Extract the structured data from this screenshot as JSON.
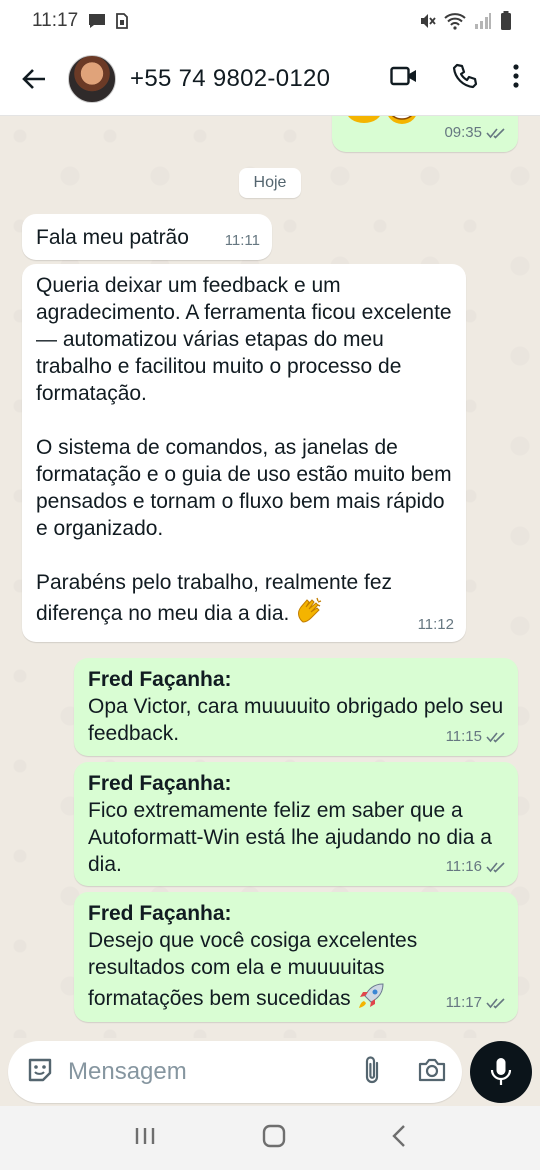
{
  "status_bar": {
    "time": "11:17",
    "icons": [
      "chat-notification-icon",
      "sim-icon",
      "mute-icon",
      "wifi-icon",
      "signal-icon",
      "battery-icon"
    ]
  },
  "header": {
    "contact_name": "+55 74 9802-0120",
    "actions": [
      "video-call-icon",
      "voice-call-icon",
      "more-options-icon"
    ]
  },
  "chat": {
    "prev_message": {
      "time": "09:35"
    },
    "day_label": "Hoje",
    "messages": [
      {
        "direction": "in",
        "text": "Fala meu patrão",
        "time": "11:11"
      },
      {
        "direction": "in",
        "paragraphs": [
          "Queria deixar um feedback e um agradecimento. A ferramenta ficou excelente — automatizou várias etapas do meu trabalho e facilitou muito o processo de formatação.",
          "O sistema de comandos, as janelas de formatação e o guia de uso estão muito bem pensados e tornam o fluxo bem mais rápido e organizado.",
          "Parabéns pelo trabalho, realmente fez diferença no meu dia a dia."
        ],
        "time": "11:12"
      },
      {
        "direction": "out",
        "sender": "Fred Façanha:",
        "text": "Opa Victor, cara muuuuito obrigado pelo seu feedback.",
        "time": "11:15"
      },
      {
        "direction": "out",
        "sender": "Fred Façanha:",
        "text": "Fico extremamente feliz em saber que a Autoformatt-Win está lhe ajudando no dia a dia.",
        "time": "11:16"
      },
      {
        "direction": "out",
        "sender": "Fred Façanha:",
        "text": "Desejo que você cosiga excelentes resultados com ela e muuuuitas formatações bem sucedidas",
        "time": "11:17"
      }
    ]
  },
  "input": {
    "placeholder": "Mensagem"
  },
  "colors": {
    "outgoing_bubble": "#d9fdd3",
    "incoming_bubble": "#ffffff",
    "chat_background": "#efeae2",
    "read_ticks": "#667781"
  }
}
